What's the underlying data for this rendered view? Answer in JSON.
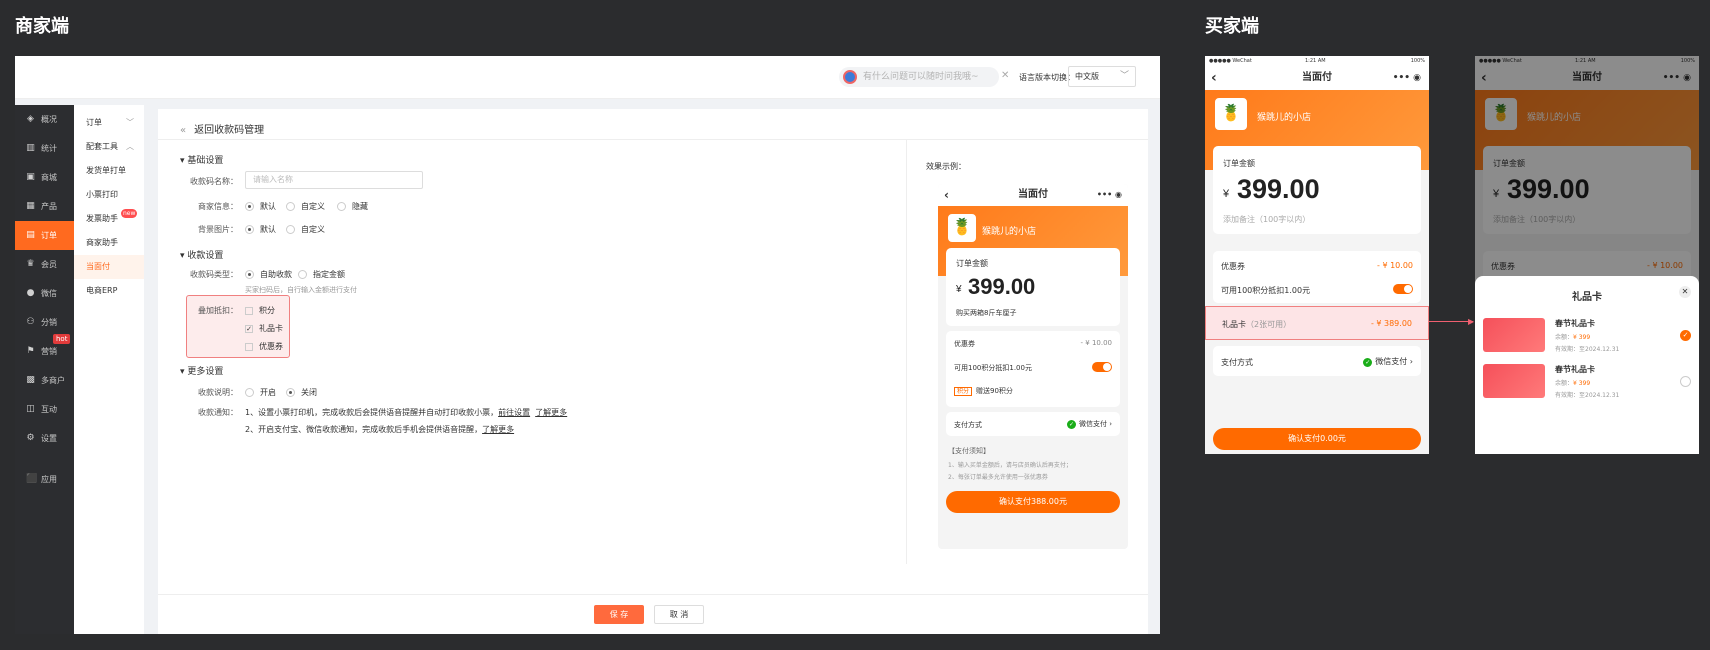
{
  "sections": {
    "merchant": "商家端",
    "buyer": "买家端"
  },
  "topbar": {
    "search_placeholder": "有什么问题可以随时问我哦~",
    "lang_label": "语言版本切换：",
    "lang_value": "中文版"
  },
  "sidebar": {
    "items": [
      {
        "label": "概况",
        "icon": "layers-icon"
      },
      {
        "label": "统计",
        "icon": "stats-icon"
      },
      {
        "label": "商城",
        "icon": "store-icon"
      },
      {
        "label": "产品",
        "icon": "product-icon"
      },
      {
        "label": "订单",
        "icon": "order-icon"
      },
      {
        "label": "会员",
        "icon": "crown-icon"
      },
      {
        "label": "微信",
        "icon": "wechat-icon"
      },
      {
        "label": "分销",
        "icon": "distribution-icon"
      },
      {
        "label": "营销",
        "icon": "flag-icon",
        "badge": "hot"
      },
      {
        "label": "多商户",
        "icon": "merchants-icon"
      },
      {
        "label": "互动",
        "icon": "interact-icon"
      },
      {
        "label": "设置",
        "icon": "gear-icon"
      },
      {
        "label": "应用",
        "icon": "apps-icon"
      }
    ]
  },
  "subnav": {
    "items": [
      {
        "label": "订单",
        "arrow": "﹀"
      },
      {
        "label": "配套工具",
        "arrow": "︿"
      },
      {
        "label": "发货单打单"
      },
      {
        "label": "小票打印"
      },
      {
        "label": "发票助手",
        "badge": "new"
      },
      {
        "label": "商家助手"
      },
      {
        "label": "当面付"
      },
      {
        "label": "电商ERP"
      }
    ]
  },
  "content": {
    "back": "返回收款码管理",
    "basic": "基础设置",
    "name_label": "收款码名称：",
    "name_placeholder": "请输入名称",
    "merchant_info_label": "商家信息：",
    "merchant_info_opts": [
      "默认",
      "自定义",
      "隐藏"
    ],
    "bg_label": "背景图片：",
    "bg_opts": [
      "默认",
      "自定义"
    ],
    "collect": "收款设置",
    "type_label": "收款码类型：",
    "type_opts": [
      "自助收款",
      "指定金额"
    ],
    "type_hint": "买家扫码后，自行输入金额进行支付",
    "stack_label": "叠加抵扣：",
    "stack_opts": [
      "积分",
      "礼品卡",
      "优惠券"
    ],
    "more": "更多设置",
    "desc_label": "收款说明：",
    "desc_opts": [
      "开启",
      "关闭"
    ],
    "notify_label": "收款通知：",
    "notify_1": "1、设置小票打印机，完成收款后会提供语音提醒并自动打印收款小票，",
    "notify_1_link1": "前往设置",
    "notify_1_link2": "了解更多",
    "notify_2": "2、开启支付宝、微信收款通知，完成收款后手机会提供语音提醒，",
    "notify_2_link": "了解更多",
    "effect": "效果示例：",
    "save": "保 存",
    "cancel": "取 消"
  },
  "preview": {
    "title": "当面付",
    "shop": "猴跳儿的小店",
    "amount_label": "订单金额",
    "currency": "¥",
    "amount": "399.00",
    "remark": "购买两箱8斤车厘子",
    "coupon_label": "优惠券",
    "coupon_value": "- ¥ 10.00",
    "points_text": "可用100积分抵扣1.00元",
    "gift_tag": "积分",
    "gift_text": "赠送90积分",
    "pay_label": "支付方式",
    "pay_value": "微信支付",
    "notice_title": "【支付须知】",
    "notice_1": "1、输入买单金额后，请与店员确认后再支付；",
    "notice_2": "2、每张订单最多允许使用一张优惠券",
    "confirm": "确认支付388.00元"
  },
  "buyer1": {
    "status_left": "●●●●● WeChat",
    "status_time": "1:21 AM",
    "status_right": "100%",
    "title": "当面付",
    "shop": "猴跳儿的小店",
    "amount_label": "订单金额",
    "currency": "¥",
    "amount": "399.00",
    "remark": "添加备注（100字以内）",
    "coupon_label": "优惠券",
    "coupon_value": "- ¥ 10.00",
    "points_text": "可用100积分抵扣1.00元",
    "giftcard_label": "礼品卡",
    "giftcard_count": "（2张可用）",
    "giftcard_value": "- ¥ 389.00",
    "pay_label": "支付方式",
    "pay_value": "微信支付",
    "confirm": "确认支付0.00元"
  },
  "buyer2": {
    "status_left": "●●●●● WeChat",
    "status_time": "1:21 AM",
    "status_right": "100%",
    "title": "当面付",
    "shop": "猴跳儿的小店",
    "amount_label": "订单金额",
    "currency": "¥",
    "amount": "399.00",
    "remark": "添加备注（100字以内）",
    "coupon_label": "优惠券",
    "coupon_value": "- ¥ 10.00",
    "sheet_title": "礼品卡",
    "cards": [
      {
        "name": "春节礼品卡",
        "balance_label": "余额：",
        "balance": "¥ 399",
        "expiry": "有效期：至2024.12.31",
        "selected": true
      },
      {
        "name": "春节礼品卡",
        "balance_label": "余额：",
        "balance": "¥ 399",
        "expiry": "有效期：至2024.12.31",
        "selected": false
      }
    ]
  },
  "colors": {
    "accent": "#ff6a1f",
    "sidebar_bg": "#2c2d30",
    "highlight_red": "#f08080"
  }
}
